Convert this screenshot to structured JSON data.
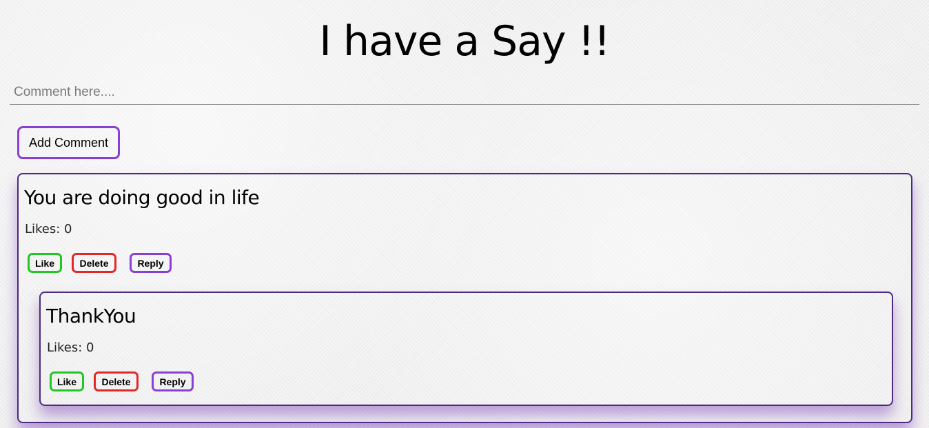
{
  "header": {
    "title": "I have a Say !!"
  },
  "composer": {
    "placeholder": "Comment here....",
    "value": "",
    "add_label": "Add Comment"
  },
  "comments": [
    {
      "text": "You are doing good in life",
      "likes_label": "Likes: 0",
      "likes": 0,
      "actions": {
        "like": "Like",
        "delete": "Delete",
        "reply": "Reply"
      },
      "replies": [
        {
          "text": "ThankYou",
          "likes_label": "Likes: 0",
          "likes": 0,
          "actions": {
            "like": "Like",
            "delete": "Delete",
            "reply": "Reply"
          }
        }
      ]
    }
  ],
  "colors": {
    "like_border": "#22c622",
    "delete_border": "#e02828",
    "reply_border": "#8a3fd4",
    "card_border": "#4a2a82",
    "card_shadow": "#8c5abe"
  }
}
